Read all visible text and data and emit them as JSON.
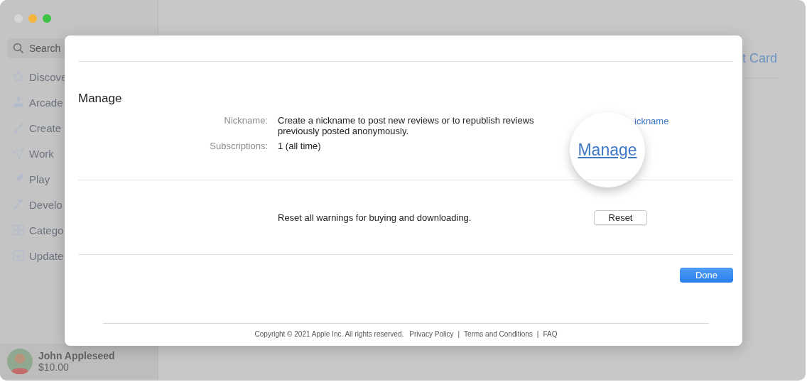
{
  "sidebar": {
    "search": {
      "placeholder": "Search"
    },
    "items": [
      {
        "label": "Discove",
        "kind": "star"
      },
      {
        "label": "Arcade",
        "kind": "joystick"
      },
      {
        "label": "Create",
        "kind": "brush"
      },
      {
        "label": "Work",
        "kind": "plane"
      },
      {
        "label": "Play",
        "kind": "rocket"
      },
      {
        "label": "Develo",
        "kind": "hammer"
      },
      {
        "label": "Catego",
        "kind": "grid"
      },
      {
        "label": "Update",
        "kind": "download"
      }
    ],
    "user": {
      "name": "John Appleseed",
      "balance": "$10.00"
    }
  },
  "background": {
    "link_fragment": "t Card"
  },
  "dialog": {
    "section_title": "Manage",
    "fields": [
      {
        "label": "Nickname:",
        "value": "Create a nickname to post new reviews or to republish reviews previously posted anonymously."
      },
      {
        "label": "Subscriptions:",
        "value": "1 (all time)"
      }
    ],
    "nickname_link": "ickname",
    "magnified_link": "Manage",
    "reset": {
      "text": "Reset all warnings for buying and downloading.",
      "button": "Reset"
    },
    "done_button": "Done",
    "footer": {
      "copyright": "Copyright © 2021 Apple Inc. All rights reserved.",
      "links": [
        "Privacy Policy",
        "Terms and Conditions",
        "FAQ"
      ],
      "separator": "|"
    }
  }
}
